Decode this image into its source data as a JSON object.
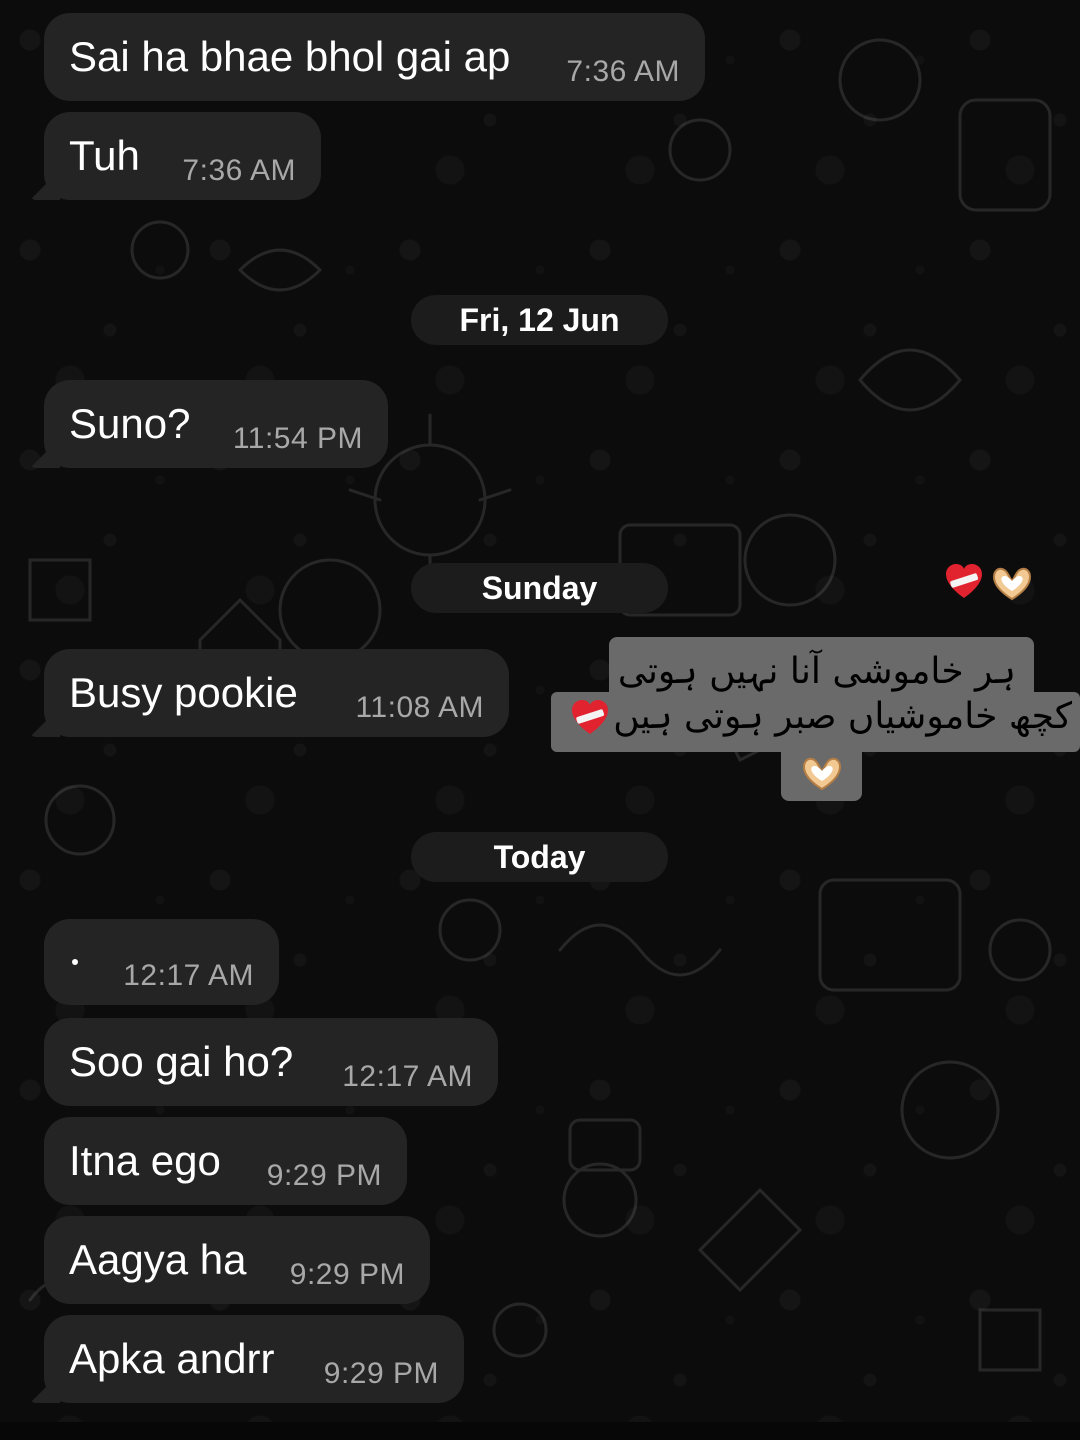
{
  "conversation": {
    "messages": [
      {
        "text": "Sai ha bhae bhol gai ap",
        "time": "7:36 AM"
      },
      {
        "text": "Tuh",
        "time": "7:36 AM"
      },
      {
        "text": "Suno?",
        "time": "11:54 PM"
      },
      {
        "text": "Busy pookie",
        "time": "11:08 AM"
      },
      {
        "text": "",
        "time": "12:17 AM"
      },
      {
        "text": "Soo gai ho?",
        "time": "12:17 AM"
      },
      {
        "text": "Itna ego",
        "time": "9:29 PM"
      },
      {
        "text": "Aagya ha",
        "time": "9:29 PM"
      },
      {
        "text": "Apka andrr",
        "time": "9:29 PM"
      }
    ],
    "date_separators": [
      "Fri, 12 Jun",
      "Sunday",
      "Today"
    ]
  },
  "sticker": {
    "line1": "ہر خاموشی آنا نہیں ہوتی",
    "line2": "کچھ خاموشیاں صبر ہوتی ہیں",
    "heart_emoji": "mending-heart-icon",
    "hands_emoji": "heart-hands-icon"
  },
  "colors": {
    "bubble": "#242424",
    "background": "#0c0c0c",
    "timestamp": "#a8a8a8",
    "date_pill": "#1c1c1c",
    "sticker_bg": "#6a6a6a"
  }
}
